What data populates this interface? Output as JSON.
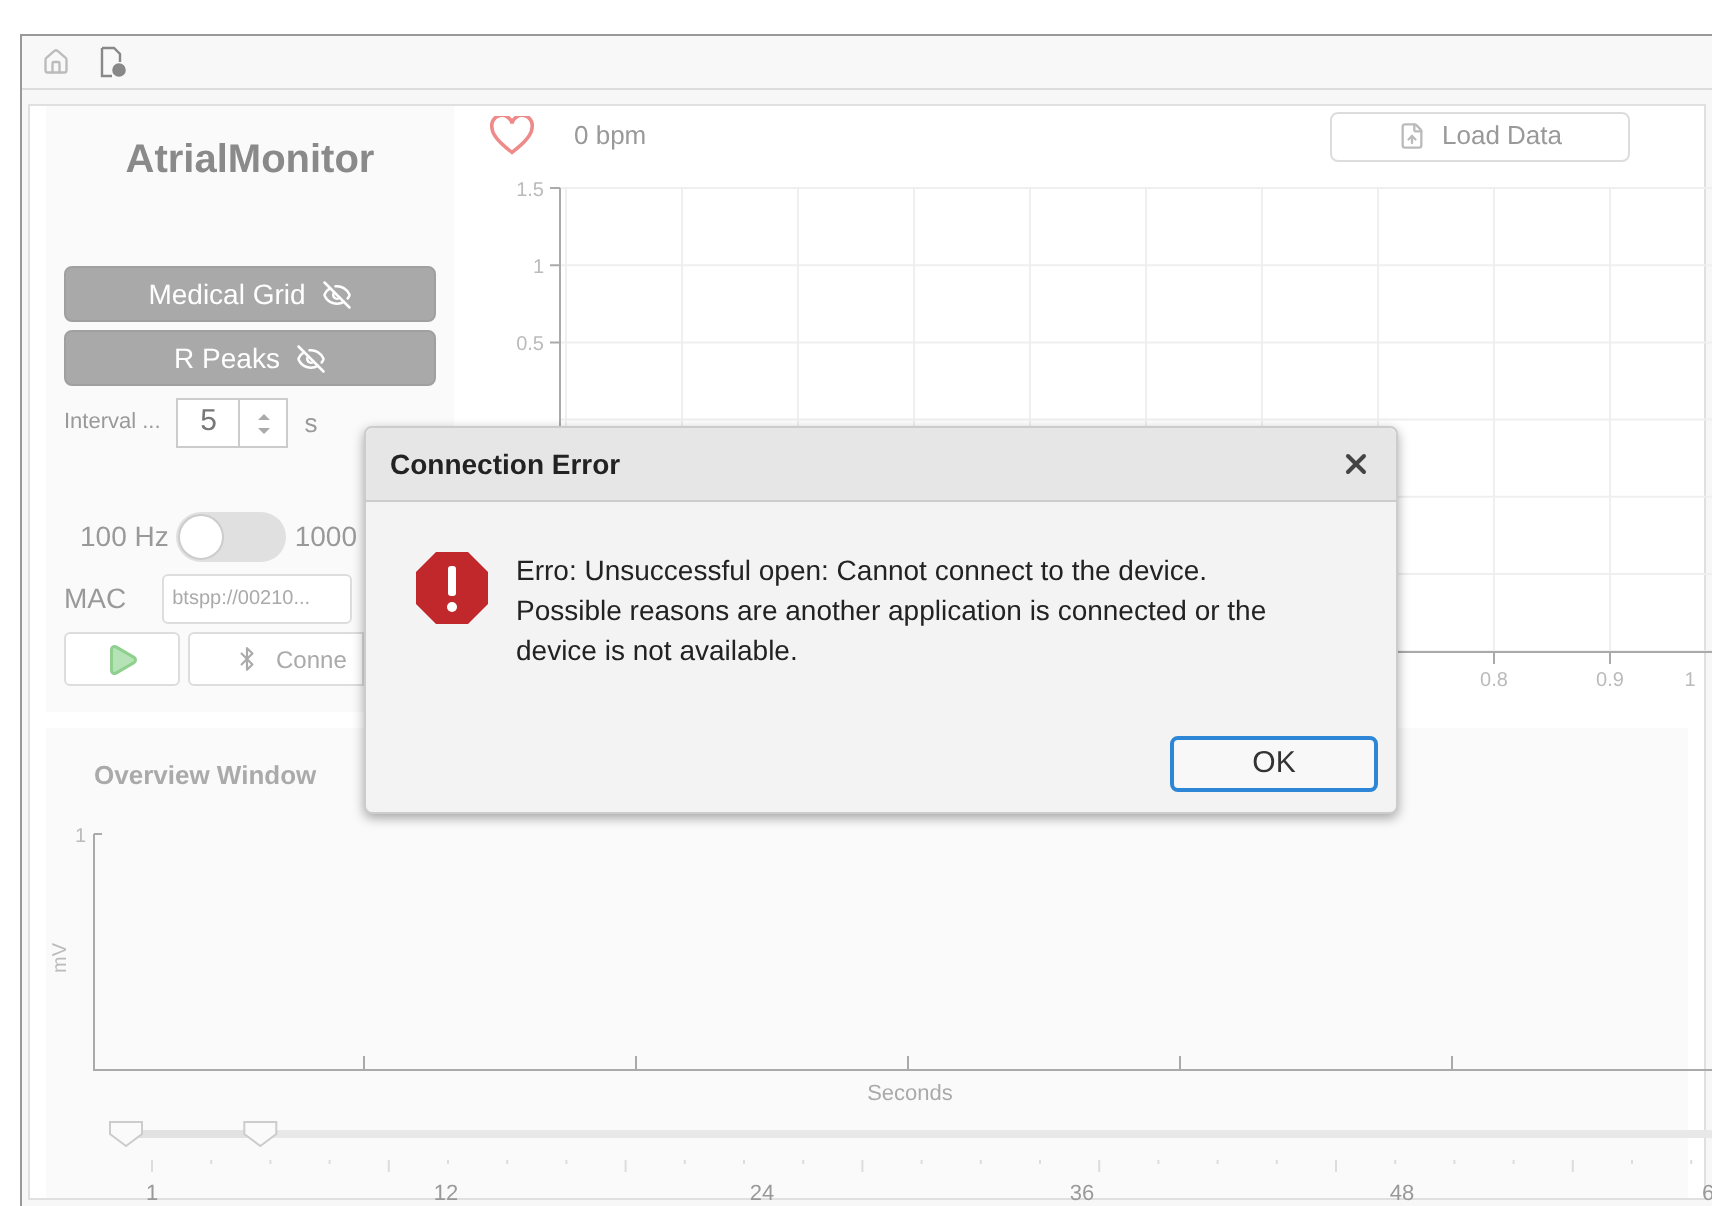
{
  "app": {
    "title": "AtrialMonitor"
  },
  "controls": {
    "medical_grid": {
      "label": "Medical Grid",
      "disabled": true
    },
    "r_peaks": {
      "label": "R Peaks",
      "disabled": true
    },
    "interval": {
      "label": "Interval ...",
      "value": "5",
      "unit": "s"
    },
    "rate_toggle": {
      "left_label": "100 Hz",
      "right_label": "1000",
      "on": false
    },
    "mac": {
      "label": "MAC",
      "value": "btspp://00210..."
    },
    "connect": {
      "label": "Conne"
    }
  },
  "monitor": {
    "heart_rate": "0 bpm",
    "load_button": "Load Data",
    "y_ticks": [
      "1.5",
      "1",
      "0.5"
    ],
    "x_ticks": [
      "0.8",
      "0.9",
      "1"
    ]
  },
  "overview": {
    "title": "Overview Window",
    "y_tick": "1",
    "ylabel": "mV",
    "xlabel": "Seconds",
    "range_slider": {
      "level": 0.085,
      "ticks": [
        "1",
        "12",
        "24",
        "36",
        "48",
        "6"
      ]
    }
  },
  "dialog": {
    "title": "Connection Error",
    "message": "Erro: Unsuccessful open: Cannot connect to the device. Possible reasons are another application is connected or the device is not available.",
    "ok": "OK"
  }
}
